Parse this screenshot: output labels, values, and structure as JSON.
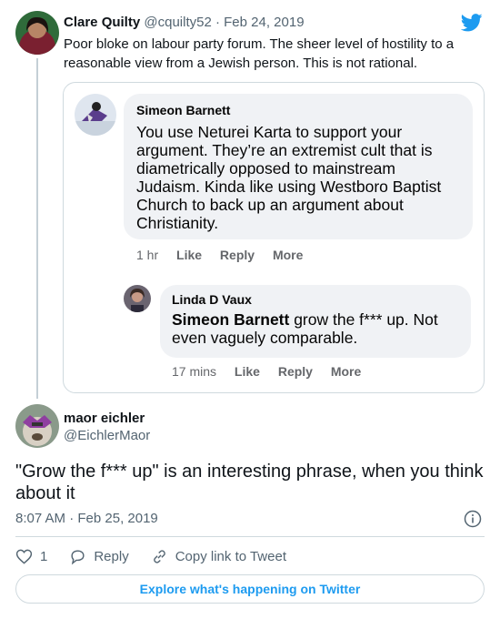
{
  "tweet": {
    "author_name": "Clare Quilty",
    "meta": "@cquilty52 · Feb 24, 2019",
    "text": "Poor bloke on labour party forum. The sheer level of hostility to a reasonable view from a Jewish person. This is not rational."
  },
  "embedded_image": {
    "comment1": {
      "name": "Simeon Barnett",
      "text": "You use Neturei Karta to support your argument. They’re an extremist cult that is diametrically opposed to mainstream Judaism. Kinda like using Westboro Baptist Church to back up an argument about Christianity.",
      "time": "1 hr",
      "like": "Like",
      "reply": "Reply",
      "more": "More"
    },
    "comment2": {
      "name": "Linda D Vaux",
      "mention": "Simeon Barnett",
      "text": " grow the f*** up. Not even vaguely comparable.",
      "time": "17 mins",
      "like": "Like",
      "reply": "Reply",
      "more": "More"
    }
  },
  "reply": {
    "author_name": "maor eichler",
    "handle": "@EichlerMaor",
    "text": "\"Grow the f*** up\" is an interesting phrase, when you think about it",
    "timestamp": "8:07 AM · Feb 25, 2019",
    "like_count": "1",
    "reply_label": "Reply",
    "copy_link_label": "Copy link to Tweet"
  },
  "explore_label": "Explore what's happening on Twitter",
  "icons": {
    "brand": "twitter-bird-icon",
    "info": "info-icon",
    "like": "heart-icon",
    "reply": "speech-bubble-icon",
    "copy_link": "link-icon"
  },
  "colors": {
    "twitter_blue": "#1d9bf0",
    "text_primary": "#0f1419",
    "text_secondary": "#536471",
    "fb_bubble": "#f0f2f5"
  }
}
